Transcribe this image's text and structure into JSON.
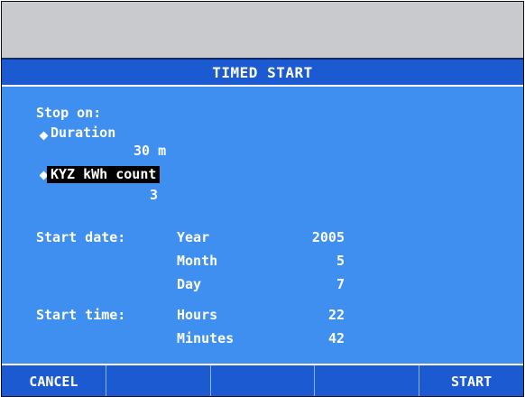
{
  "dialog": {
    "title": "TIMED START",
    "stop_on_label": "Stop on:",
    "options": [
      {
        "label": "Duration",
        "value": "30 m",
        "selected": false
      },
      {
        "label": "KYZ kWh count",
        "value": "3",
        "selected": true
      }
    ],
    "start_date": {
      "label": "Start date:",
      "fields": [
        {
          "label": "Year",
          "value": "2005"
        },
        {
          "label": "Month",
          "value": "5"
        },
        {
          "label": "Day",
          "value": "7"
        }
      ]
    },
    "start_time": {
      "label": "Start time:",
      "fields": [
        {
          "label": "Hours",
          "value": "22"
        },
        {
          "label": "Minutes",
          "value": "42"
        }
      ]
    }
  },
  "softkeys": [
    {
      "label": "CANCEL"
    },
    {
      "label": ""
    },
    {
      "label": ""
    },
    {
      "label": ""
    },
    {
      "label": "START"
    }
  ],
  "colors": {
    "background": "#3f8ff0",
    "title_bar": "#1c5ad1",
    "top_panel": "#c8cacd",
    "highlight": "#000000"
  }
}
